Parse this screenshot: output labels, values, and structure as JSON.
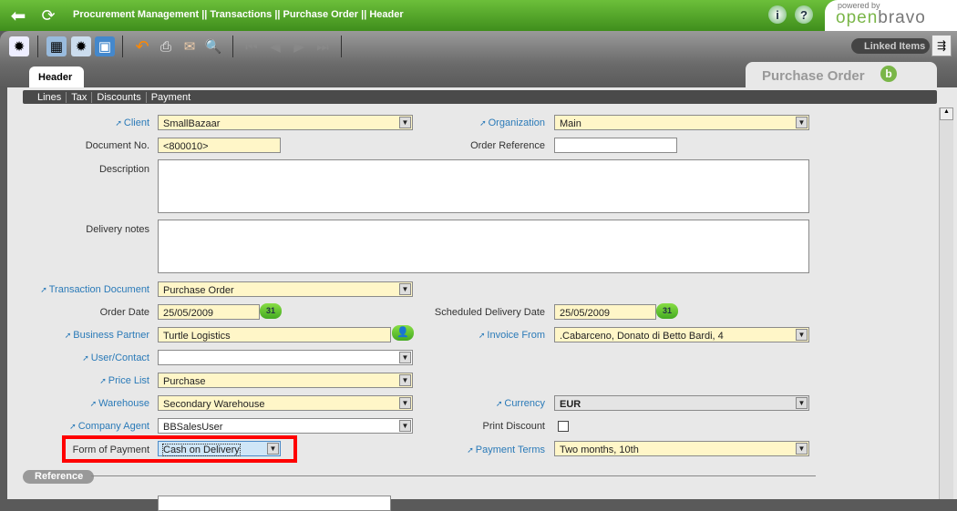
{
  "header": {
    "breadcrumb": "Procurement Management || Transactions || Purchase Order  ||  Header",
    "powered_by": "powered by",
    "logo_open": "open",
    "logo_bravo": "bravo"
  },
  "toolbar": {
    "linked_items": "Linked Items"
  },
  "tabs": {
    "active": "Header",
    "window_title": "Purchase Order",
    "subtabs": [
      "Lines",
      "Tax",
      "Discounts",
      "Payment"
    ]
  },
  "form": {
    "client": {
      "label": "Client",
      "value": "SmallBazaar"
    },
    "organization": {
      "label": "Organization",
      "value": "Main"
    },
    "document_no": {
      "label": "Document No.",
      "value": "<800010>"
    },
    "order_reference": {
      "label": "Order Reference",
      "value": ""
    },
    "description": {
      "label": "Description",
      "value": ""
    },
    "delivery_notes": {
      "label": "Delivery notes",
      "value": ""
    },
    "transaction_document": {
      "label": "Transaction Document",
      "value": "Purchase Order"
    },
    "order_date": {
      "label": "Order Date",
      "value": "25/05/2009"
    },
    "scheduled_delivery_date": {
      "label": "Scheduled Delivery Date",
      "value": "25/05/2009"
    },
    "business_partner": {
      "label": "Business Partner",
      "value": "Turtle Logistics"
    },
    "invoice_from": {
      "label": "Invoice From",
      "value": ".Cabarceno, Donato di Betto Bardi, 4"
    },
    "user_contact": {
      "label": "User/Contact",
      "value": ""
    },
    "price_list": {
      "label": "Price List",
      "value": "Purchase"
    },
    "warehouse": {
      "label": "Warehouse",
      "value": "Secondary Warehouse"
    },
    "currency": {
      "label": "Currency",
      "value": "EUR"
    },
    "company_agent": {
      "label": "Company Agent",
      "value": "BBSalesUser"
    },
    "print_discount": {
      "label": "Print Discount",
      "checked": false
    },
    "form_of_payment": {
      "label": "Form of Payment",
      "value": "Cash on Delivery"
    },
    "payment_terms": {
      "label": "Payment Terms",
      "value": "Two months, 10th"
    },
    "calendar_text": "31"
  },
  "sections": {
    "reference": "Reference"
  }
}
